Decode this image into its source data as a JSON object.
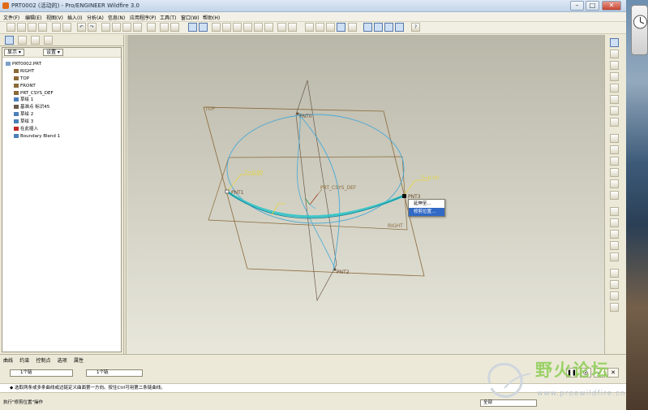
{
  "window": {
    "title": "PRT0002 (活动的) - Pro/ENGINEER Wildfire 3.0"
  },
  "menu": [
    "文件(F)",
    "编辑(E)",
    "视图(V)",
    "插入(I)",
    "分析(A)",
    "信息(N)",
    "应用程序(P)",
    "工具(T)",
    "窗口(W)",
    "帮助(H)"
  ],
  "panel": {
    "show_label": "显示 ▾",
    "settings_label": "设置 ▾",
    "tree": [
      {
        "label": "PRT0002.PRT",
        "indent": 0,
        "icon": "part-icon"
      },
      {
        "label": "RIGHT",
        "indent": 1,
        "icon": "datum-plane-icon"
      },
      {
        "label": "TOP",
        "indent": 1,
        "icon": "datum-plane-icon"
      },
      {
        "label": "FRONT",
        "indent": 1,
        "icon": "datum-plane-icon"
      },
      {
        "label": "PRT_CSYS_DEF",
        "indent": 1,
        "icon": "csys-icon"
      },
      {
        "label": "草绘 1",
        "indent": 1,
        "icon": "sketch-icon"
      },
      {
        "label": "基准点 标识45",
        "indent": 1,
        "icon": "datum-point-icon"
      },
      {
        "label": "草绘 2",
        "indent": 1,
        "icon": "sketch-icon"
      },
      {
        "label": "草绘 3",
        "indent": 1,
        "icon": "sketch-icon"
      },
      {
        "label": "在此插入",
        "indent": 1,
        "icon": "insert-arrow-icon"
      },
      {
        "label": "Boundary Blend 1",
        "indent": 1,
        "icon": "boundary-blend-icon"
      }
    ]
  },
  "viewport": {
    "labels": {
      "top": "TOP",
      "pnt0": "PNT0",
      "pnt1": "PNT1",
      "pnt2": "PNT2",
      "pnt3": "PNT3",
      "csys": "PRT_CSYS_DEF",
      "right": "RIGHT",
      "t_left": "T=0.00",
      "t_right": "T=0.00"
    }
  },
  "context_menu": {
    "items": [
      "延伸至...",
      "修剪位置..."
    ],
    "selected_index": 1
  },
  "dashboard": {
    "tabs": [
      "曲线",
      "约束",
      "控制点",
      "选项",
      "属性"
    ],
    "collector1": "1个链",
    "collector2": "1个链",
    "message": "◆ 选取两条或多条曲线或边链定义曲面第一方向。按住Ctrl可用第二条链曲线。",
    "status": "执行\"修剪位置\"操作",
    "filter": "全部"
  },
  "watermark": {
    "text": "野火论坛",
    "url": "www.proewildfire.cn"
  },
  "colors": {
    "curve": "#49a9d6",
    "datum": "#8a6a3a",
    "highlight": "#2fc4c8",
    "select_blue": "#316ac5"
  }
}
